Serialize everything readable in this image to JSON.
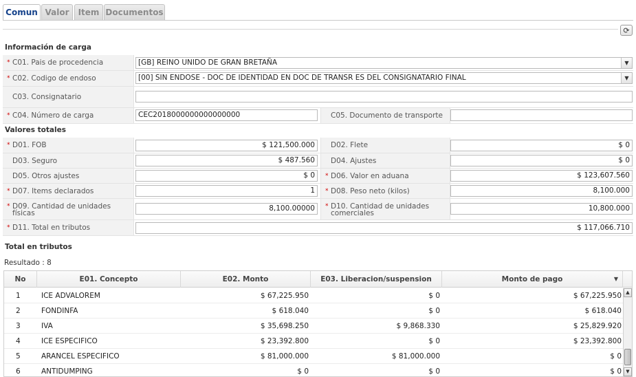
{
  "tabs": [
    {
      "label": "Comun"
    },
    {
      "label": "Valor"
    },
    {
      "label": "Item"
    },
    {
      "label": "Documentos"
    }
  ],
  "sections": {
    "carga": "Información de carga",
    "valores": "Valores totales",
    "tributos": "Total en tributos"
  },
  "carga": {
    "c01_label": "C01. Pais de procedencia",
    "c01_value": "[GB] REINO UNIDO DE GRAN BRETAÑA",
    "c02_label": "C02. Codigo de endoso",
    "c02_value": "[00] SIN ENDOSE - DOC DE IDENTIDAD EN DOC DE TRANSR ES DEL CONSIGNATARIO FINAL",
    "c03_label": "C03. Consignatario",
    "c03_value": "",
    "c04_label": "C04. Número de carga",
    "c04_value": "CEC2018000000000000000",
    "c05_label": "C05. Documento de transporte",
    "c05_value": ""
  },
  "valores": {
    "d01_label": "D01. FOB",
    "d01_value": "$ 121,500.000",
    "d02_label": "D02. Flete",
    "d02_value": "$ 0",
    "d03_label": "D03. Seguro",
    "d03_value": "$ 487.560",
    "d04_label": "D04. Ajustes",
    "d04_value": "$ 0",
    "d05_label": "D05. Otros ajustes",
    "d05_value": "$ 0",
    "d06_label": "D06. Valor en aduana",
    "d06_value": "$ 123,607.560",
    "d07_label": "D07. Items declarados",
    "d07_value": "1",
    "d08_label": "D08. Peso neto (kilos)",
    "d08_value": "8,100.000",
    "d09_label_1": "D09. Cantidad de unidades",
    "d09_label_2": "físicas",
    "d09_value": "8,100.00000",
    "d10_label_1": "D10. Cantidad de unidades",
    "d10_label_2": "comerciales",
    "d10_value": "10,800.000",
    "d11_label": "D11. Total en tributos",
    "d11_value": "$ 117,066.710"
  },
  "table": {
    "result": "Resultado : 8",
    "columns": [
      "No",
      "E01. Concepto",
      "E02. Monto",
      "E03. Liberacion/suspension",
      "Monto de pago"
    ],
    "sort_icon": "▼",
    "rows": [
      {
        "no": "1",
        "concepto": "ICE ADVALOREM",
        "monto": "$ 67,225.950",
        "liberacion": "$ 0",
        "pago": "$ 67,225.950"
      },
      {
        "no": "2",
        "concepto": "FONDINFA",
        "monto": "$ 618.040",
        "liberacion": "$ 0",
        "pago": "$ 618.040"
      },
      {
        "no": "3",
        "concepto": "IVA",
        "monto": "$ 35,698.250",
        "liberacion": "$ 9,868.330",
        "pago": "$ 25,829.920"
      },
      {
        "no": "4",
        "concepto": "ICE ESPECIFICO",
        "monto": "$ 23,392.800",
        "liberacion": "$ 0",
        "pago": "$ 23,392.800"
      },
      {
        "no": "5",
        "concepto": "ARANCEL ESPECIFICO",
        "monto": "$ 81,000.000",
        "liberacion": "$ 81,000.000",
        "pago": "$ 0"
      },
      {
        "no": "6",
        "concepto": "ANTIDUMPING",
        "monto": "$ 0",
        "liberacion": "$ 0",
        "pago": "$ 0"
      }
    ]
  },
  "icons": {
    "refresh": "refresh-icon",
    "dropdown": "chevron-down-icon",
    "scroll_up": "▲",
    "scroll_down": "▼",
    "select_arrow": "▼",
    "refresh_glyph": "⟳",
    "required_mark": "*"
  }
}
